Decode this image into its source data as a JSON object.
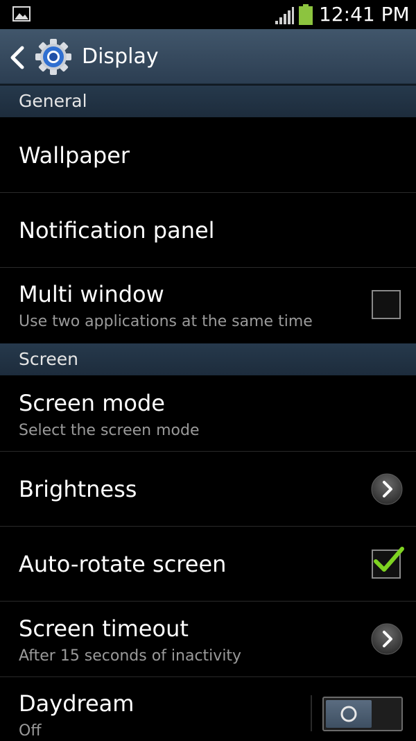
{
  "status_bar": {
    "time": "12:41 PM"
  },
  "action_bar": {
    "title": "Display",
    "icon": "gear-icon",
    "back": "chevron-left-icon"
  },
  "sections": {
    "general": "General",
    "screen": "Screen"
  },
  "items": {
    "wallpaper": {
      "title": "Wallpaper"
    },
    "notification_panel": {
      "title": "Notification panel"
    },
    "multi_window": {
      "title": "Multi window",
      "subtitle": "Use two applications at the same time",
      "checked": false
    },
    "screen_mode": {
      "title": "Screen mode",
      "subtitle": "Select the screen mode"
    },
    "brightness": {
      "title": "Brightness"
    },
    "auto_rotate": {
      "title": "Auto-rotate screen",
      "checked": true
    },
    "screen_timeout": {
      "title": "Screen timeout",
      "subtitle": "After 15 seconds of inactivity"
    },
    "daydream": {
      "title": "Daydream",
      "subtitle": "Off",
      "enabled": false
    }
  },
  "colors": {
    "check_green": "#7ed321",
    "battery_green": "#8cc43f",
    "action_bar": "#3a4f64",
    "section_header": "#22344a"
  }
}
